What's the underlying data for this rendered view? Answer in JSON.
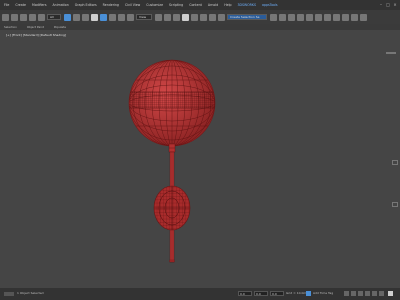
{
  "menubar": {
    "items": [
      "File",
      "Create",
      "Modifiers",
      "Animation",
      "Graph Editors",
      "Rendering",
      "Civil View",
      "Customize",
      "Scripting",
      "Content",
      "Arnold",
      "Help",
      "3DSWORKS",
      "appsTools"
    ],
    "highlighted": [
      "3DSWORKS",
      "appsTools"
    ]
  },
  "toolbar": {
    "filter_dropdown": "All",
    "view_dropdown": "View",
    "selection_set_dropdown": "Create Selection Se"
  },
  "subtabs": [
    "Selection",
    "Object Paint",
    "Populate"
  ],
  "viewport": {
    "label": "[+] [Front] [Standard] [Default Shading]"
  },
  "statusbar": {
    "left_text": "1 Object Selected",
    "x_value": "0.0",
    "y_value": "0.0",
    "z_value": "0.0",
    "grid_text": "Grid = 10.0mm",
    "addtime_text": "Add Time Tag"
  },
  "colors": {
    "mesh_red": "#c23a3a",
    "accent_blue": "#4a90d8"
  }
}
